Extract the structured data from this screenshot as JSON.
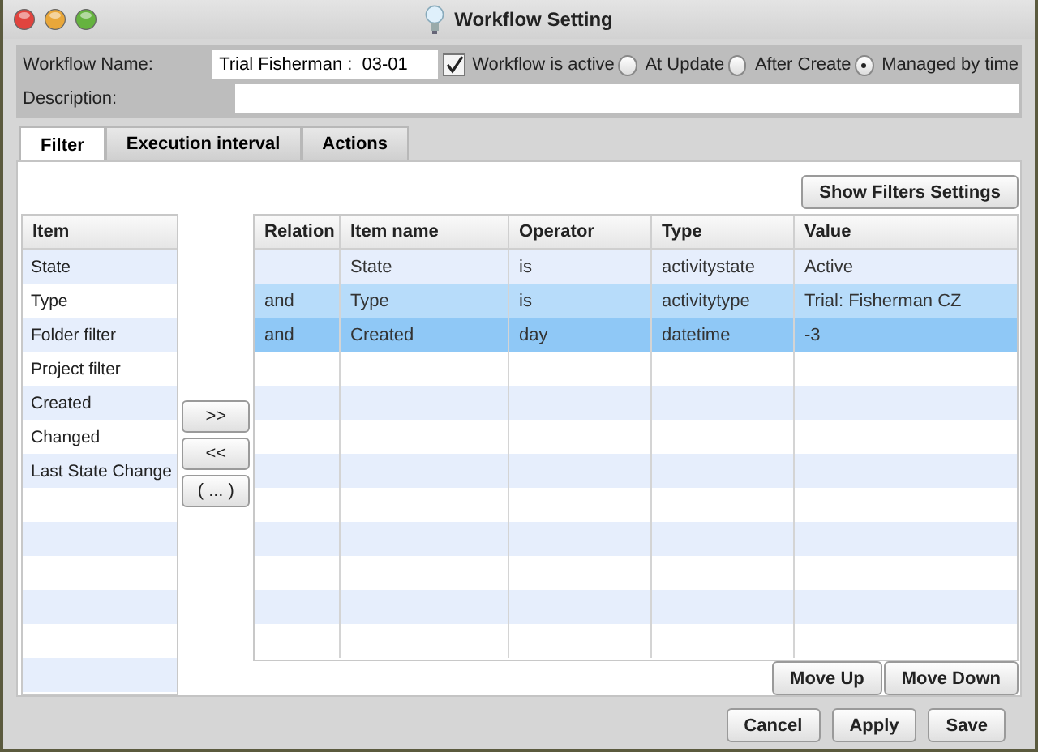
{
  "window": {
    "title": "Workflow Setting"
  },
  "form": {
    "name_label": "Workflow Name:",
    "name_value": "Trial Fisherman :  03-01",
    "active": {
      "label": "Workflow is active",
      "checked": true
    },
    "modes": [
      {
        "label": "At Update",
        "selected": false
      },
      {
        "label": "After Create",
        "selected": false
      },
      {
        "label": "Managed by time",
        "selected": true
      }
    ],
    "description_label": "Description:"
  },
  "tabs": [
    {
      "label": "Filter",
      "selected": true
    },
    {
      "label": "Execution interval",
      "selected": false
    },
    {
      "label": "Actions",
      "selected": false
    }
  ],
  "show_filters_button": "Show Filters Settings",
  "item_list": {
    "header": "Item",
    "items": [
      "State",
      "Type",
      "Folder filter",
      "Project filter",
      "Created",
      "Changed",
      "Last State Change"
    ]
  },
  "transfer_buttons": [
    ">>",
    "<<",
    "( ... )"
  ],
  "filter_table": {
    "columns": [
      "Relation",
      "Item name",
      "Operator",
      "Type",
      "Value"
    ],
    "rows": [
      {
        "cells": [
          "",
          "State",
          "is",
          "activitystate",
          "Active"
        ],
        "selected": false,
        "focused": false
      },
      {
        "cells": [
          "and",
          "Type",
          "is",
          "activitytype",
          "Trial: Fisherman CZ"
        ],
        "selected": true,
        "focused": false
      },
      {
        "cells": [
          "and",
          "Created",
          "day",
          "datetime",
          "-3"
        ],
        "selected": true,
        "focused": true
      }
    ]
  },
  "move_buttons": [
    "Move Up",
    "Move Down"
  ],
  "footer_buttons": [
    "Cancel",
    "Apply",
    "Save"
  ]
}
